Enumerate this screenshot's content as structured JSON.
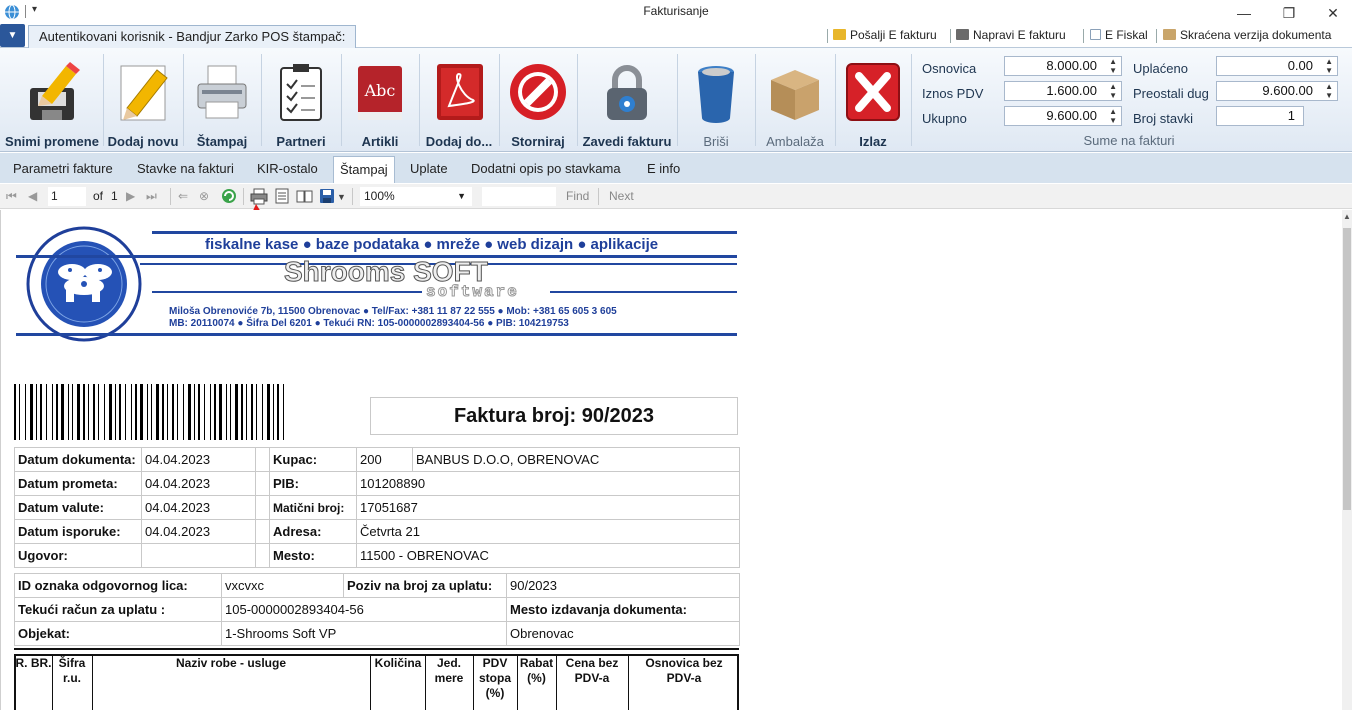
{
  "window": {
    "title": "Fakturisanje",
    "controls": {
      "minimize": "—",
      "restore": "❐",
      "close": "✕"
    }
  },
  "tabrow": {
    "user_tab": "Autentikovani korisnik - Bandjur Zarko POS štampač:",
    "quick_actions": [
      {
        "label": "Pošalji E fakturu",
        "icon": "envelope-icon",
        "color": "#e8b62a"
      },
      {
        "label": "Napravi E fakturu",
        "icon": "card-icon",
        "color": "#6a6a6a"
      },
      {
        "label": "E Fiskal",
        "icon": "document-icon",
        "color": "#8aa0b8"
      },
      {
        "label": "Skraćena verzija dokumenta",
        "icon": "calculator-icon",
        "color": "#c9a56a"
      }
    ]
  },
  "ribbon": {
    "buttons": [
      {
        "label": "Snimi promene",
        "icon": "floppy-pencil-icon",
        "enabled": true
      },
      {
        "label": "Dodaj novu",
        "icon": "pencil-paper-icon",
        "enabled": true
      },
      {
        "label": "Štampaj",
        "icon": "printer-icon",
        "enabled": true
      },
      {
        "label": "Partneri",
        "icon": "clipboard-icon",
        "enabled": true
      },
      {
        "label": "Artikli",
        "icon": "book-abc-icon",
        "enabled": true
      },
      {
        "label": "Dodaj do...",
        "icon": "pdf-icon",
        "enabled": true
      },
      {
        "label": "Storniraj",
        "icon": "no-entry-icon",
        "enabled": true
      },
      {
        "label": "Zavedi fakturu",
        "icon": "padlock-icon",
        "enabled": true
      },
      {
        "label": "Briši",
        "icon": "trash-can-icon",
        "enabled": false
      },
      {
        "label": "Ambalaža",
        "icon": "box-icon",
        "enabled": false
      },
      {
        "label": "Izlaz",
        "icon": "exit-x-icon",
        "enabled": true
      }
    ],
    "sums": {
      "title": "Sume na fakturi",
      "osnovica_label": "Osnovica",
      "osnovica": "8.000.00",
      "iznos_pdv_label": "Iznos PDV",
      "iznos_pdv": "1.600.00",
      "ukupno_label": "Ukupno",
      "ukupno": "9.600.00",
      "uplaceno_label": "Uplaćeno",
      "uplaceno": "0.00",
      "preostali_label": "Preostali dug",
      "preostali": "9.600.00",
      "broj_stavki_label": "Broj stavki",
      "broj_stavki": "1"
    }
  },
  "section_tabs": [
    "Parametri fakture",
    "Stavke na fakturi",
    "KIR-ostalo",
    "Štampaj",
    "Uplate",
    "Dodatni opis po stavkama",
    "E info"
  ],
  "active_section": "Štampaj",
  "report_toolbar": {
    "page": "1",
    "of_label": "of",
    "total_pages": "1",
    "zoom": "100%",
    "find_label": "Find",
    "next_label": "Next"
  },
  "report": {
    "company_tagline": "fiskalne kase ● baze podataka ● mreže ● web dizajn ● aplikacije",
    "company_name": "Shrooms SOFT",
    "company_sub": "software",
    "address_line": "Miloša Obrenoviće 7b, 11500 Obrenovac  ● Tel/Fax: +381 11 87 22 555  ● Mob: +381 65 605 3 605",
    "ids_line": "MB: 20110074 ● Šifra Del 6201 ● Tekući RN: 105-0000002893404-56 ● PIB: 104219753",
    "logo_ring_text": "office@shroomssoft.net ● www.shroomssoft.net ● www.shroomssoft.net",
    "invoice_title": "Faktura broj: 90/2023",
    "details": [
      {
        "label": "Datum dokumenta:",
        "value": "04.04.2023",
        "label2": "Kupac:",
        "value2": "200",
        "value3": "BANBUS D.O.O, OBRENOVAC"
      },
      {
        "label": "Datum prometa:",
        "value": "04.04.2023",
        "label2": "PIB:",
        "value2": "101208890",
        "value3": ""
      },
      {
        "label": "Datum valute:",
        "value": "04.04.2023",
        "label2": "Matični broj:",
        "value2": "17051687",
        "value3": ""
      },
      {
        "label": "Datum isporuke:",
        "value": "04.04.2023",
        "label2": "Adresa:",
        "value2": "Četvrta 21",
        "value3": ""
      },
      {
        "label": "Ugovor:",
        "value": "",
        "label2": "Mesto:",
        "value2": "11500 - OBRENOVAC",
        "value3": ""
      }
    ],
    "payment": {
      "id_label": "ID oznaka odgovornog lica:",
      "id_value": "vxcvxc",
      "poziv_label": "Poziv na broj za uplatu:",
      "poziv_value": "90/2023",
      "racun_label": "Tekući račun za uplatu :",
      "racun_value": "105-0000002893404-56",
      "mesto_label": "Mesto izdavanja dokumenta:",
      "objekat_label": "Objekat:",
      "objekat_value": "1-Shrooms Soft VP",
      "mesto_value": "Obrenovac"
    },
    "item_columns": [
      "R. BR.",
      "Šifra r.u.",
      "Naziv robe - usluge",
      "Količina",
      "Jed. mere",
      "PDV stopa (%)",
      "Rabat (%)",
      "Cena bez PDV-a",
      "Osnovica bez PDV-a"
    ]
  }
}
